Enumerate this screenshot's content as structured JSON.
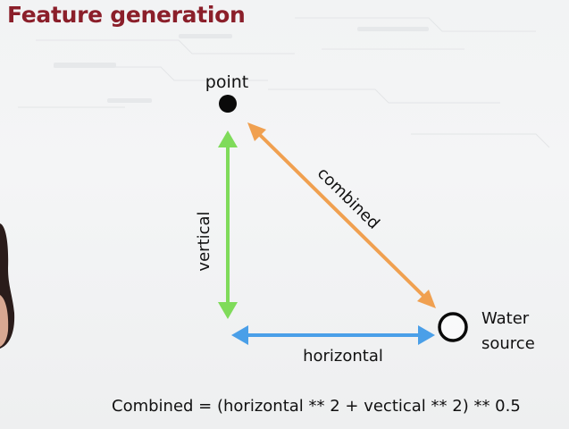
{
  "slide": {
    "title": "Feature generation",
    "formula": "Combined = (horizontal ** 2 + vectical ** 2) ** 0.5"
  },
  "diagram": {
    "point_label": "point",
    "water_label_line1": "Water",
    "water_label_line2": "source",
    "vertical_label": "vertical",
    "horizontal_label": "horizontal",
    "combined_label": "combined",
    "colors": {
      "vertical": "#7fdb5a",
      "horizontal": "#4a9fe8",
      "combined": "#f0a050",
      "title": "#8b1f2a"
    }
  }
}
